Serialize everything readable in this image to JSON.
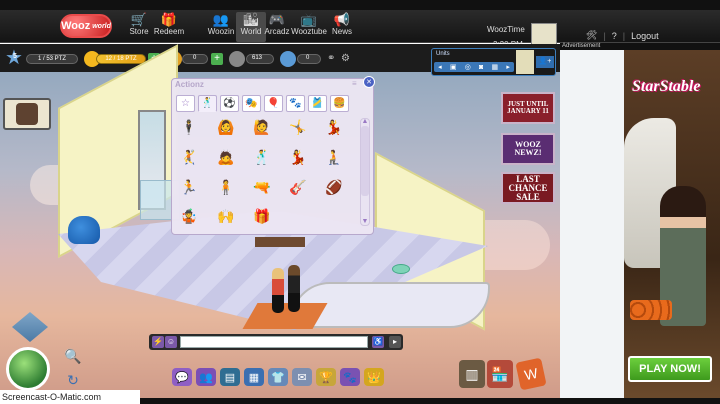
{
  "nav": {
    "logo": "Wooz",
    "logo_sub": "world",
    "items": [
      {
        "label": "Store",
        "icon": "cart-icon"
      },
      {
        "label": "Redeem",
        "icon": "gift-icon"
      },
      {
        "label": "Woozin",
        "icon": "woozin-icon"
      },
      {
        "label": "World",
        "icon": "world-icon",
        "active": true
      },
      {
        "label": "Arcadz",
        "icon": "gamepad-icon"
      },
      {
        "label": "Wooztube",
        "icon": "tv-icon"
      },
      {
        "label": "News",
        "icon": "megaphone-icon"
      }
    ],
    "username": "WoozTime",
    "time": "2:20 PM",
    "help": "?",
    "logout": "Logout"
  },
  "stats": {
    "level": "5",
    "xp": "1 / 53 PTZ",
    "energy": "12 / 18 PTZ",
    "coins": "0",
    "gems": "613",
    "likes": "0"
  },
  "units": {
    "title": "Units"
  },
  "actionz": {
    "title": "Actionz",
    "min": "≡",
    "close": "✕",
    "tabs": [
      "☆",
      "🕺",
      "⚽",
      "🎭",
      "🎈",
      "🐾",
      "🎽",
      "🍔"
    ],
    "poses": [
      "🕴",
      "🙆",
      "🙋",
      "🤸",
      "💃",
      "🤾",
      "🙇",
      "🕺",
      "💃",
      "🧎",
      "🏃",
      "🧍",
      "🔫",
      "🎸",
      "🏈",
      "🤹",
      "🙌",
      "🎁"
    ]
  },
  "promos": {
    "p1_a": "JUST UNTIL",
    "p1_b": "JANUARY 11",
    "p2_a": "WOOZ",
    "p2_b": "NEWZ!",
    "p3_a": "LAST",
    "p3_b": "CHANCE",
    "p3_c": "SALE"
  },
  "chat": {
    "placeholder": ""
  },
  "ad": {
    "label": "Advertisement",
    "title": "StarStable",
    "cta": "PLAY NOW!"
  },
  "footer": {
    "watermark": "Screencast-O-Matic.com"
  },
  "colors": {
    "accent": "#3e7fbd",
    "panel": "#ebe5f3",
    "logo": "#c81f1f"
  }
}
